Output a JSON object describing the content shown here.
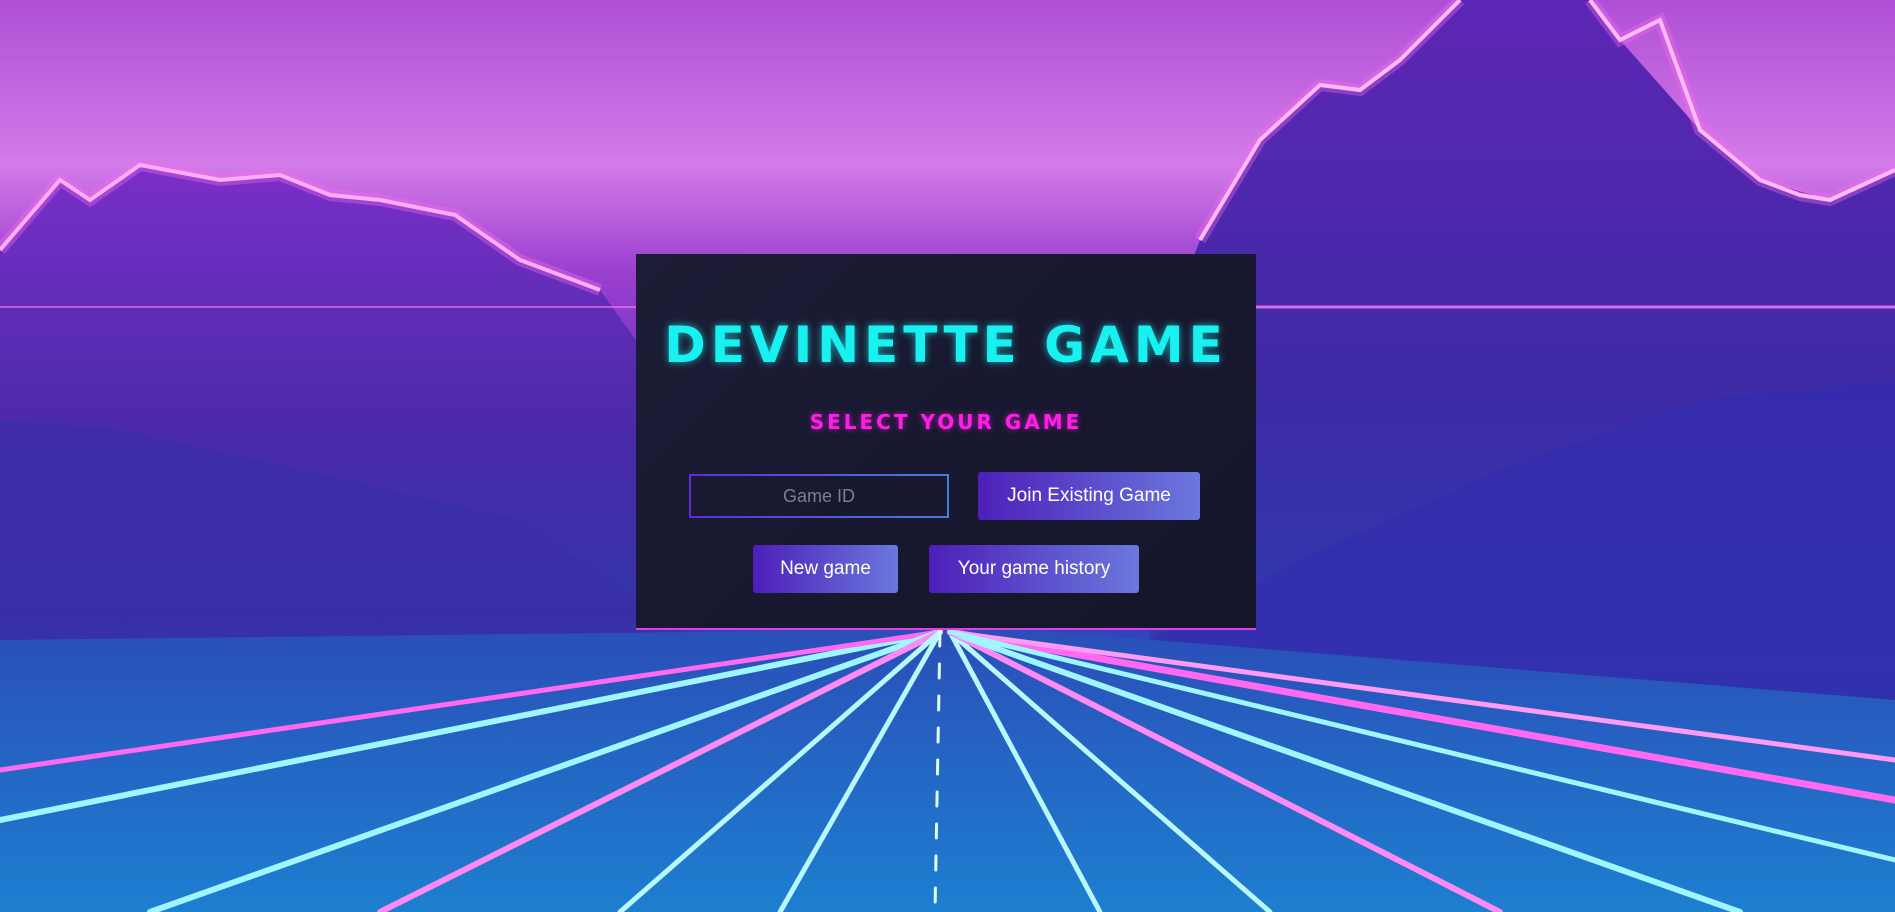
{
  "app": {
    "title": "DEVINETTE GAME",
    "subtitle": "SELECT YOUR GAME"
  },
  "join": {
    "input_placeholder": "Game ID",
    "input_value": "",
    "button_label": "Join Existing Game"
  },
  "actions": {
    "new_game_label": "New game",
    "history_label": "Your game history"
  },
  "colors": {
    "title": "#19f0f0",
    "subtitle": "#ff1ee8",
    "panel": "#17182f",
    "button_start": "#4d1fb9",
    "button_end": "#6a78dd"
  },
  "background": {
    "description_icon": "synthwave-mountains-road-background"
  }
}
